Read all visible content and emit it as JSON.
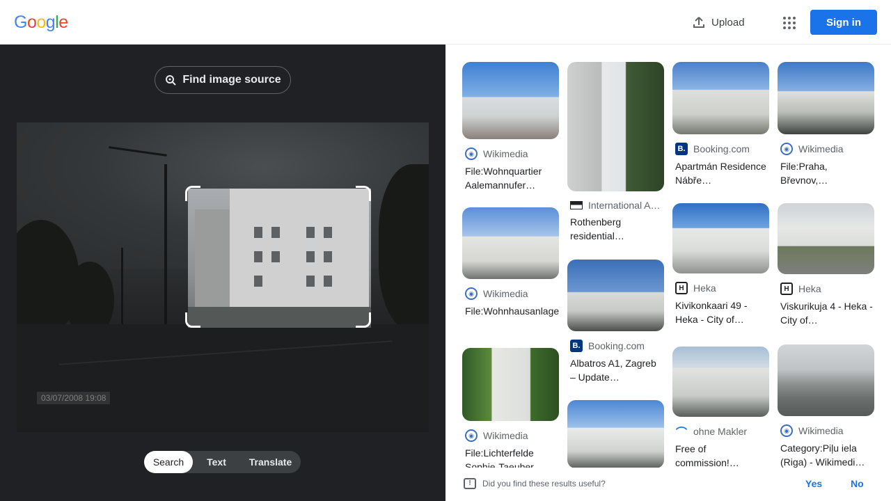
{
  "header": {
    "logo_letters": [
      {
        "ch": "G",
        "color": "#4285f4"
      },
      {
        "ch": "o",
        "color": "#ea4335"
      },
      {
        "ch": "o",
        "color": "#fbbc05"
      },
      {
        "ch": "g",
        "color": "#4285f4"
      },
      {
        "ch": "l",
        "color": "#34a853"
      },
      {
        "ch": "e",
        "color": "#ea4335"
      }
    ],
    "upload_label": "Upload",
    "upload_icon": "upload-icon",
    "apps_icon": "apps-grid-icon",
    "signin_label": "Sign in"
  },
  "left_panel": {
    "find_source_label": "Find image source",
    "find_source_icon": "lens-search-icon",
    "photo_timestamp": "03/07/2008 19:08",
    "tabs": [
      {
        "label": "Search",
        "active": true
      },
      {
        "label": "Text",
        "active": false
      },
      {
        "label": "Translate",
        "active": false
      }
    ]
  },
  "results": [
    {
      "source": "Wikimedia",
      "source_icon": "wikimedia-icon",
      "title": "File:Wohnquartier Aalemannufer…"
    },
    {
      "source": "Wikimedia",
      "source_icon": "wikimedia-icon",
      "title": "File:Wohnhausanlage…"
    },
    {
      "source": "Wikimedia",
      "source_icon": "wikimedia-icon",
      "title": "File:Lichterfelde Sophie-Taeuber…"
    },
    {
      "source": "International A…",
      "source_icon": "international-icon",
      "title": "Rothenberg residential…"
    },
    {
      "source": "Booking.com",
      "source_icon": "booking-icon",
      "title": "Albatros A1, Zagreb – Update…"
    },
    {
      "source": "Booking.com",
      "source_icon": "booking-icon",
      "title": "Apartmán Residence Nábře…"
    },
    {
      "source": "Heka",
      "source_icon": "heka-icon",
      "title": "Kivikonkaari 49 - Heka - City of…"
    },
    {
      "source": "ohne Makler",
      "source_icon": "ohne-makler-icon",
      "title": "Free of commission!…"
    },
    {
      "source": "Wikimedia",
      "source_icon": "wikimedia-icon",
      "title": "File:Praha, Břevnov,…"
    },
    {
      "source": "Heka",
      "source_icon": "heka-icon",
      "title": "Viskurikuja 4 - Heka - City of…"
    },
    {
      "source": "Wikimedia",
      "source_icon": "wikimedia-icon",
      "title": "Category:Piļu iela (Riga) - Wikimedi…"
    }
  ],
  "feedback": {
    "question": "Did you find these results useful?",
    "yes_label": "Yes",
    "no_label": "No"
  }
}
